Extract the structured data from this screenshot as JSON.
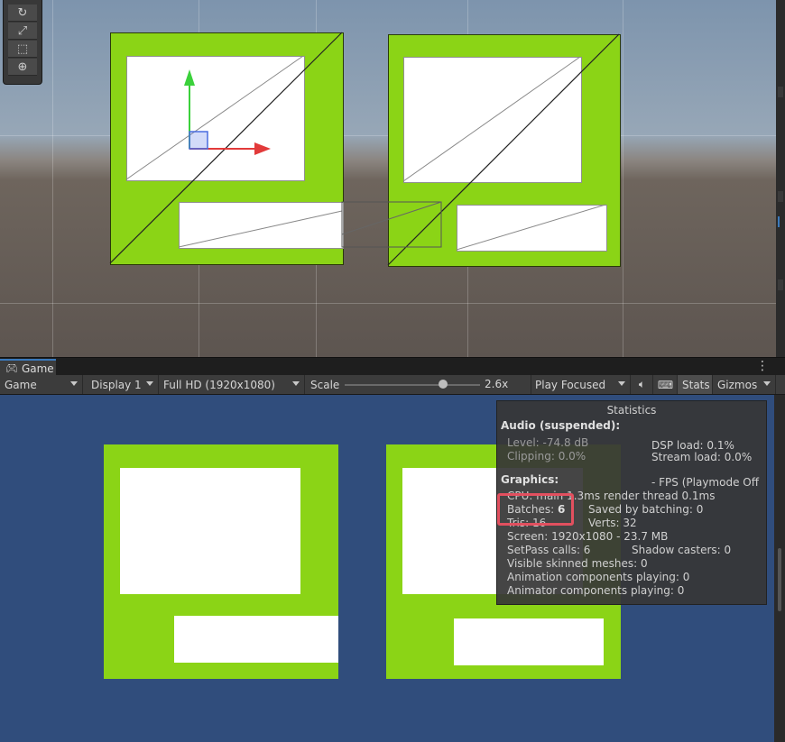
{
  "game_tab": {
    "label": "Game"
  },
  "toolbar": {
    "view_dropdown": "Game",
    "display_dropdown": "Display 1",
    "resolution_dropdown": "Full HD (1920x1080)",
    "scale_label": "Scale",
    "scale_value": "2.6x",
    "play_mode_dropdown": "Play Focused",
    "stats_button": "Stats",
    "gizmos_button": "Gizmos"
  },
  "stats": {
    "title": "Statistics",
    "audio_header": "Audio (suspended):",
    "level": "Level: -74.8 dB",
    "clipping": "Clipping: 0.0%",
    "dsp_load": "DSP load: 0.1%",
    "stream_load": "Stream load: 0.0%",
    "graphics_header": "Graphics:",
    "fps": "- FPS (Playmode Off",
    "cpu": "CPU: main 1.3ms  render thread 0.1ms",
    "batches_label": "Batches:",
    "batches_value": "6",
    "saved_by_batching": "Saved by batching: 0",
    "tris": "Tris: 16",
    "verts": "Verts: 32",
    "screen": "Screen: 1920x1080 - 23.7 MB",
    "setpass": "SetPass calls: 6",
    "shadow_casters": "Shadow casters: 0",
    "skinned": "Visible skinned meshes: 0",
    "animation": "Animation components playing: 0",
    "animator": "Animator components playing: 0"
  },
  "icons": [
    "rotate-tool-icon",
    "scale-tool-icon",
    "rect-tool-icon",
    "transform-tool-icon",
    "gamepad-icon",
    "audio-icon",
    "grid-icon",
    "kebab-menu-icon"
  ],
  "colors": {
    "game_background": "#304d7c",
    "panel_green": "#8bd416",
    "highlight": "#e2505f"
  }
}
